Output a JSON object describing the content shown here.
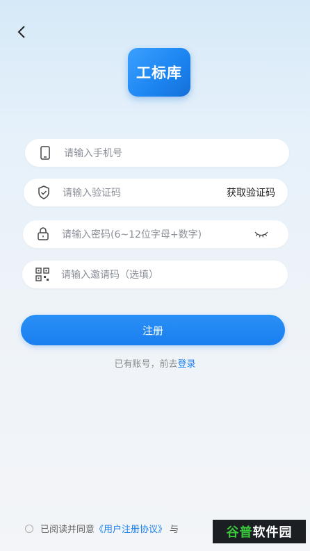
{
  "app": {
    "logo_text": "工标库"
  },
  "form": {
    "phone_placeholder": "请输入手机号",
    "code_placeholder": "请输入验证码",
    "get_code_label": "获取验证码",
    "password_placeholder": "请输入密码(6~12位字母+数字)",
    "invite_placeholder": "请输入邀请码（选填）"
  },
  "actions": {
    "register_label": "注册",
    "have_account_text": "已有账号，前去",
    "login_link": "登录"
  },
  "agreement": {
    "text": "已阅读并同意",
    "link": "《用户注册协议》",
    "and": "与"
  },
  "watermark": {
    "part1": "谷普",
    "part2": "软件园"
  },
  "colors": {
    "accent": "#1a7ef0",
    "logo_bg": "#2a8ff5"
  },
  "icons": [
    "back-arrow-icon",
    "phone-icon",
    "shield-icon",
    "lock-icon",
    "eye-closed-icon",
    "qrcode-icon"
  ]
}
